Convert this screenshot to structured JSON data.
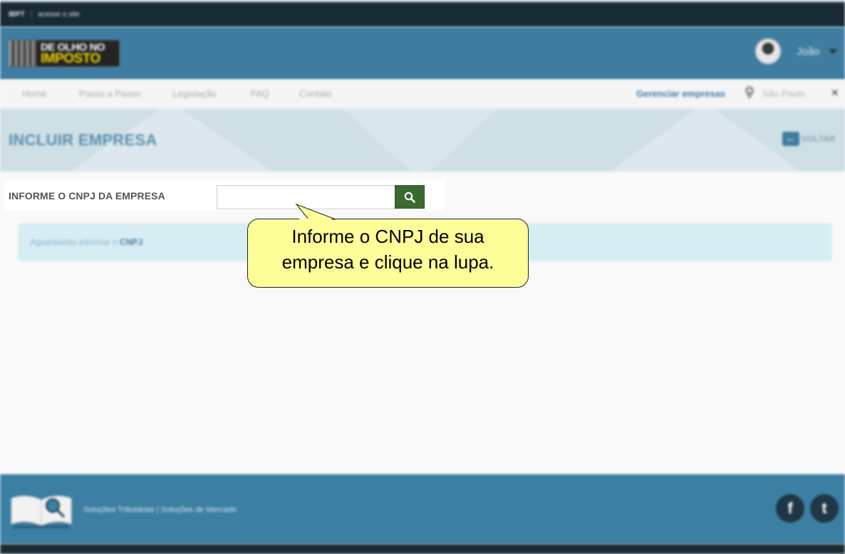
{
  "topbar": {
    "brand": "IBPT",
    "link": "acesse o site"
  },
  "header": {
    "logo_line1": "DE OLHO NO",
    "logo_line2": "IMPOSTO",
    "user_name": "João"
  },
  "nav": {
    "items": [
      "Home",
      "Passo a Passo",
      "Legislação",
      "FAQ",
      "Contato"
    ],
    "manage": "Gerenciar empresas",
    "city": "São Paulo"
  },
  "page": {
    "title": "INCLUIR EMPRESA",
    "back_label": "VOLTAR"
  },
  "form": {
    "cnpj_label": "INFORME O CNPJ DA EMPRESA",
    "cnpj_value": "",
    "cnpj_placeholder": ""
  },
  "status": {
    "text_prefix": "Aguardando informar o ",
    "text_bold": "CNPJ",
    "text_suffix": "."
  },
  "tooltip": {
    "line1": "Informe o CNPJ de sua",
    "line2": "empresa e clique na lupa."
  },
  "footer": {
    "text": "Soluções Tributárias | Soluções de Mercado"
  },
  "icons": {
    "search": "search-icon",
    "back": "arrow-left-icon",
    "pin": "map-pin-icon",
    "facebook": "facebook-icon",
    "twitter": "twitter-icon"
  },
  "colors": {
    "topbar": "#172a36",
    "header": "#3f7da0",
    "search_button": "#3a6a2f",
    "status_box": "#d7edf4",
    "tooltip": "#ffff99",
    "footer": "#3b7fa3"
  }
}
